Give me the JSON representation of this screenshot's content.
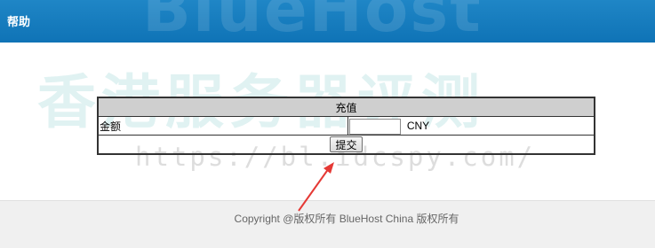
{
  "header": {
    "title": "帮助",
    "watermark": "BlueHost"
  },
  "watermarks": {
    "chinese": "香港服务器评测",
    "url": "https://bl.idcspy.com/"
  },
  "form": {
    "title": "充值",
    "amount_label": "金额",
    "amount_value": "",
    "currency": "CNY",
    "submit_label": "提交"
  },
  "annotation": {
    "arrow_icon": "red-arrow-icon",
    "color": "#e53935"
  },
  "footer": {
    "text": "Copyright @版权所有 BlueHost China 版权所有"
  },
  "colors": {
    "header_bg": "#1a80c2",
    "table_title_bg": "#cfcfcf",
    "footer_bg": "#f0f0f0"
  }
}
